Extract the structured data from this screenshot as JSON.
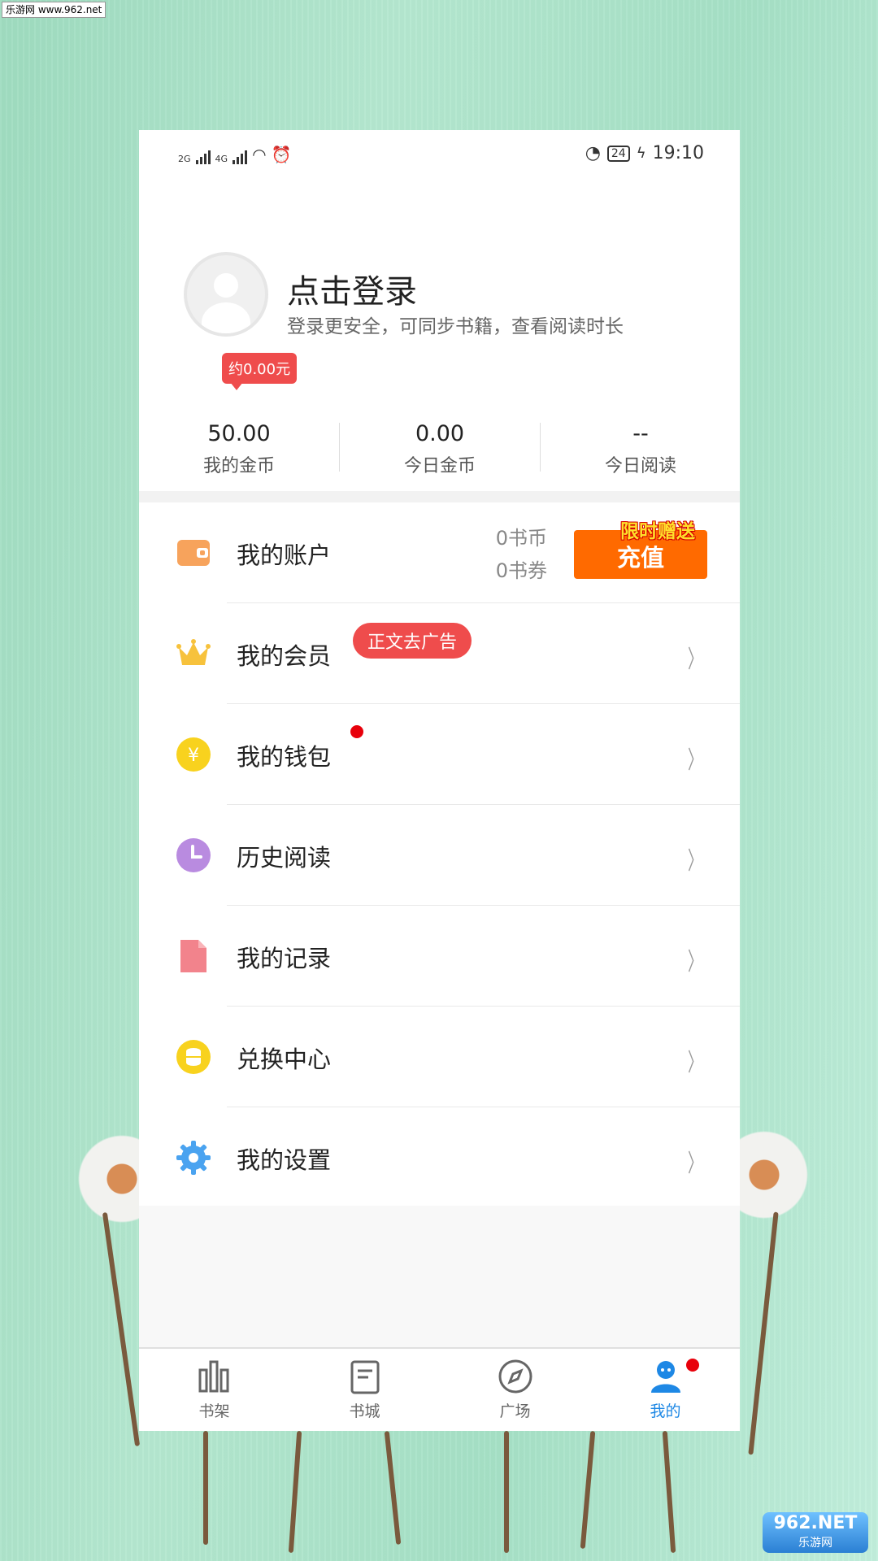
{
  "watermark": {
    "top": "乐游网 www.962.net",
    "bottom_logo": "962.NET",
    "bottom_sub": "乐游网"
  },
  "status_bar": {
    "network1": "2G",
    "network2": "4G",
    "battery": "24",
    "time": "19:10"
  },
  "profile": {
    "title": "点击登录",
    "subtitle": "登录更安全，可同步书籍，查看阅读时长"
  },
  "stats": {
    "badge": "约0.00元",
    "items": [
      {
        "value": "50.00",
        "label": "我的金币"
      },
      {
        "value": "0.00",
        "label": "今日金币"
      },
      {
        "value": "--",
        "label": "今日阅读"
      }
    ]
  },
  "account": {
    "label": "我的账户",
    "coins": "0书币",
    "vouchers": "0书券",
    "recharge": "充值",
    "promo": "限时赠送"
  },
  "menu": [
    {
      "label": "我的会员",
      "tag": "正文去广告"
    },
    {
      "label": "我的钱包"
    },
    {
      "label": "历史阅读"
    },
    {
      "label": "我的记录"
    },
    {
      "label": "兑换中心"
    },
    {
      "label": "我的设置"
    }
  ],
  "tabs": [
    {
      "label": "书架"
    },
    {
      "label": "书城"
    },
    {
      "label": "广场"
    },
    {
      "label": "我的"
    }
  ],
  "colors": {
    "accent": "#1e88e5",
    "recharge": "#ff6a00",
    "badge": "#ef4c4c"
  }
}
